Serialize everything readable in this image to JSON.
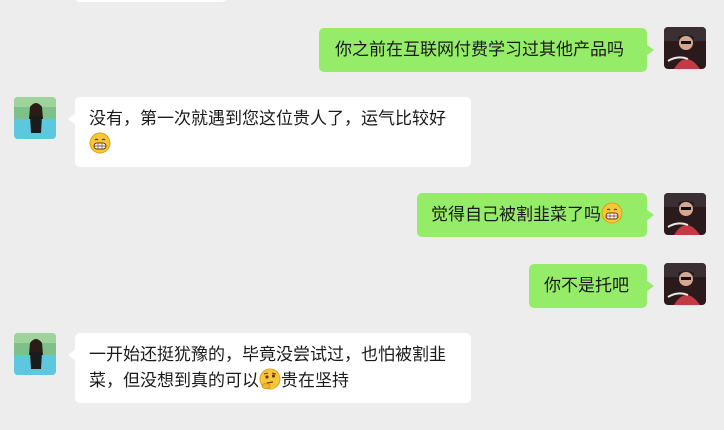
{
  "colors": {
    "background": "#ededed",
    "sent_bubble": "#95ec69",
    "received_bubble": "#ffffff"
  },
  "messages": [
    {
      "side": "right",
      "avatar": "driver-avatar",
      "text": "你之前在互联网付费学习过其他产品吗"
    },
    {
      "side": "left",
      "avatar": "woman-pool-avatar",
      "text_before": "没有，第一次就遇到您这位贵人了，运气比较好",
      "emoji": "grin-emoji",
      "text_after": ""
    },
    {
      "side": "right",
      "avatar": "driver-avatar",
      "text_before": "觉得自己被割韭菜了吗",
      "emoji": "grin-emoji",
      "text_after": ""
    },
    {
      "side": "right",
      "avatar": "driver-avatar",
      "text": "你不是托吧"
    },
    {
      "side": "left",
      "avatar": "woman-pool-avatar",
      "text_line1": "一开始还挺犹豫的，毕竟没尝试过，也怕被割韭",
      "text_before": "菜，但没想到真的可以",
      "emoji": "thinking-emoji",
      "text_after": "贵在坚持"
    }
  ]
}
